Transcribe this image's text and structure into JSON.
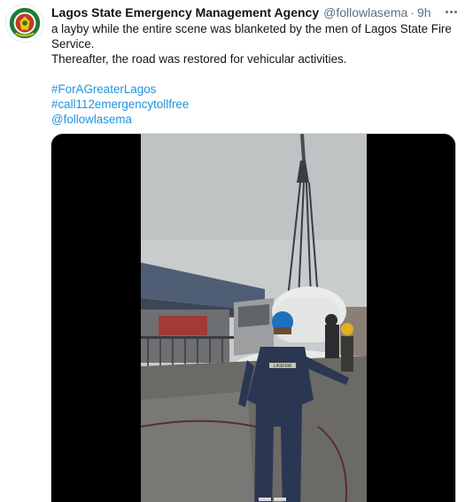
{
  "tweet": {
    "display_name": "Lagos State Emergency Management Agency",
    "handle": "@followlasema",
    "separator": "·",
    "time": "9h",
    "lines": [
      "a layby while the entire scene was blanketed by the men of Lagos State Fire",
      "Service.",
      "Thereafter, the road was restored for vehicular activities."
    ],
    "hashtags": [
      "#ForAGreaterLagos",
      "#call112emergencytollfree"
    ],
    "mention": "@followlasema",
    "avatar_icon": "lasema-seal-icon",
    "more_icon": "more-dots-icon"
  },
  "media": {
    "type": "video",
    "vest_text": "LASEMA",
    "colors": {
      "background": "#000000",
      "sky": "#c9cccc",
      "road": "#6b6a66",
      "uniform": "#2b3752",
      "helmet": "#1f6fc0",
      "tanker": "#e9ece9"
    }
  },
  "colors": {
    "link": "#1b95e0",
    "text": "#0f1419",
    "muted": "#5b7083",
    "border": "#cfd9de"
  }
}
